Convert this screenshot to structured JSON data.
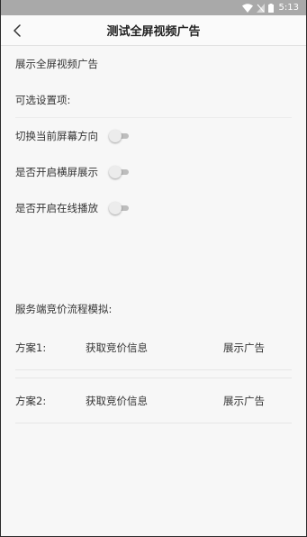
{
  "status": {
    "time": "5:13"
  },
  "header": {
    "title": "测试全屏视频广告"
  },
  "description": "展示全屏视频广告",
  "options_title": "可选设置项:",
  "toggles": [
    {
      "label": "切换当前屏幕方向",
      "on": false
    },
    {
      "label": "是否开启横屏展示",
      "on": false
    },
    {
      "label": "是否开启在线播放",
      "on": false
    }
  ],
  "simulation_title": "服务端竞价流程模拟:",
  "plans": [
    {
      "name": "方案1:",
      "fetch_label": "获取竞价信息",
      "show_label": "展示广告"
    },
    {
      "name": "方案2:",
      "fetch_label": "获取竞价信息",
      "show_label": "展示广告"
    }
  ]
}
